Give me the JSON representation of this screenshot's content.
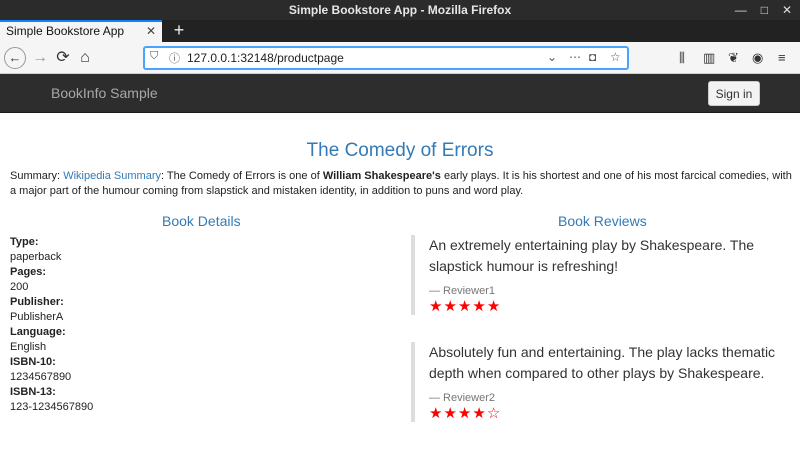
{
  "window": {
    "title": "Simple Bookstore App - Mozilla Firefox"
  },
  "tab": {
    "label": "Simple Bookstore App",
    "close": "✕",
    "new_tab": "+"
  },
  "url": {
    "value": "127.0.0.1:32148/productpage"
  },
  "app": {
    "brand": "BookInfo Sample",
    "sign_in": "Sign in"
  },
  "book": {
    "title": "The Comedy of Errors",
    "summary_label": "Summary: ",
    "summary_link": "Wikipedia Summary",
    "summary_pre": ": The Comedy of Errors is one of ",
    "summary_bold": "William Shakespeare's",
    "summary_post": " early plays. It is his shortest and one of his most farcical comedies, with a major part of the humour coming from slapstick and mistaken identity, in addition to puns and word play."
  },
  "details": {
    "heading": "Book Details",
    "fields": [
      {
        "key": "Type:",
        "value": "paperback"
      },
      {
        "key": "Pages:",
        "value": "200"
      },
      {
        "key": "Publisher:",
        "value": "PublisherA"
      },
      {
        "key": "Language:",
        "value": "English"
      },
      {
        "key": "ISBN-10:",
        "value": "1234567890"
      },
      {
        "key": "ISBN-13:",
        "value": "123-1234567890"
      }
    ]
  },
  "reviews": {
    "heading": "Book Reviews",
    "items": [
      {
        "text": "An extremely entertaining play by Shakespeare. The slapstick humour is refreshing!",
        "author": "— Reviewer1",
        "stars_filled": 5,
        "stars_total": 5,
        "star_color": "#ff0000"
      },
      {
        "text": "Absolutely fun and entertaining. The play lacks thematic depth when compared to other plays by Shakespeare.",
        "author": "— Reviewer2",
        "stars_filled": 4,
        "stars_total": 5,
        "star_color": "#ff0000"
      }
    ]
  },
  "icons": {
    "back": "back-arrow-icon",
    "forward": "forward-arrow-icon",
    "reload": "reload-icon",
    "home": "home-icon",
    "shield": "tracking-shield-icon",
    "info": "site-info-icon",
    "dropdown": "url-dropdown-icon",
    "more": "page-actions-icon",
    "pocket": "pocket-icon",
    "bookmark": "bookmark-star-icon",
    "library": "library-icon",
    "sidebar": "sidebar-icon",
    "extension": "extension-icon",
    "account": "account-icon",
    "menu": "hamburger-menu-icon"
  }
}
